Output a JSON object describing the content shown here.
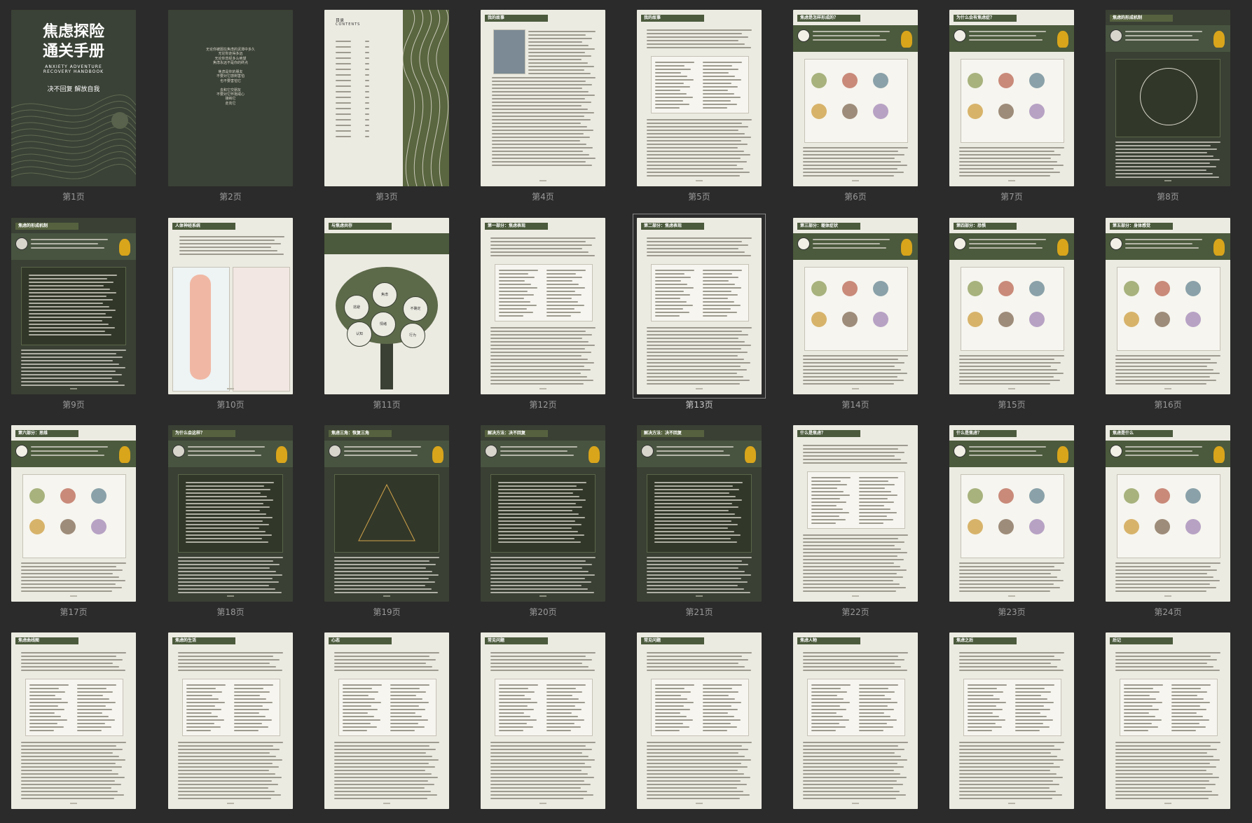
{
  "pages": [
    {
      "caption": "第1页",
      "title": "焦虑探险\n通关手册",
      "subtitle": "ANXIETY ADVENTURE\nRECOVERY HANDBOOK",
      "slogan": "决不回复  解放自我",
      "style": "cover"
    },
    {
      "caption": "第2页",
      "style": "poem",
      "poem": "无论你被困在焦虑的泥潭中多久\n无论你走得多远\n无论你曾经多么绝望\n焦虑永远不是你的终点\n\n焦虑是你的朋友\n不要对它感到害怕\n也不要害怕它\n\n去和它交朋友\n不要对它怀抱戒心\n接纳它\n走向它"
    },
    {
      "caption": "第3页",
      "style": "toc",
      "toc_title": "目录",
      "toc_sub": "CONTENTS"
    },
    {
      "caption": "第4页",
      "style": "text",
      "header": "我的故事"
    },
    {
      "caption": "第5页",
      "style": "text",
      "header": "我的故事"
    },
    {
      "caption": "第6页",
      "style": "illus",
      "header": "焦虑是怎样形成的？"
    },
    {
      "caption": "第7页",
      "style": "illus",
      "header": "为什么会有焦虑症？"
    },
    {
      "caption": "第8页",
      "style": "dark",
      "header": "焦虑的形成机制"
    },
    {
      "caption": "第9页",
      "style": "dark",
      "header": "焦虑的形成机制"
    },
    {
      "caption": "第10页",
      "style": "text",
      "header": "人体神经系统"
    },
    {
      "caption": "第11页",
      "style": "tree",
      "header": "与焦虑共存",
      "tree": [
        "焦虑",
        "逃避",
        "不确定",
        "认知",
        "行为",
        "情绪"
      ]
    },
    {
      "caption": "第12页",
      "style": "text",
      "header": "第一部分：焦虑表现"
    },
    {
      "caption": "第13页",
      "style": "text",
      "header": "第二部分：焦虑表现",
      "selected": true
    },
    {
      "caption": "第14页",
      "style": "illus",
      "header": "第三部分：躯体症状"
    },
    {
      "caption": "第15页",
      "style": "illus",
      "header": "第四部分：恐惧"
    },
    {
      "caption": "第16页",
      "style": "illus",
      "header": "第五部分：身体感觉"
    },
    {
      "caption": "第17页",
      "style": "illus",
      "header": "第六部分：思维"
    },
    {
      "caption": "第18页",
      "style": "dark",
      "header": "为什么会这样？"
    },
    {
      "caption": "第19页",
      "style": "dark",
      "header": "焦虑三角：恢复三角"
    },
    {
      "caption": "第20页",
      "style": "dark",
      "header": "解决方法：决不回复"
    },
    {
      "caption": "第21页",
      "style": "dark",
      "header": "解决方法：决不回复"
    },
    {
      "caption": "第22页",
      "style": "text",
      "header": "什么是焦虑？"
    },
    {
      "caption": "第23页",
      "style": "illus",
      "header": "什么是焦虑？"
    },
    {
      "caption": "第24页",
      "style": "illus",
      "header": "焦虑是什么"
    },
    {
      "caption": "",
      "style": "text",
      "header": "焦虑曲线图"
    },
    {
      "caption": "",
      "style": "text",
      "header": "焦虑的生活"
    },
    {
      "caption": "",
      "style": "text",
      "header": "心态"
    },
    {
      "caption": "",
      "style": "text",
      "header": "常见问题"
    },
    {
      "caption": "",
      "style": "text",
      "header": "常见问题"
    },
    {
      "caption": "",
      "style": "text",
      "header": "焦虑人物"
    },
    {
      "caption": "",
      "style": "text",
      "header": "焦虑之后"
    },
    {
      "caption": "",
      "style": "text",
      "header": "后记"
    }
  ],
  "colors": {
    "background": "#2b2b2b",
    "caption": "#9a9a9a",
    "page_light": "#ecebe2",
    "page_dark": "#3a4034",
    "accent": "#4b5a3c"
  }
}
